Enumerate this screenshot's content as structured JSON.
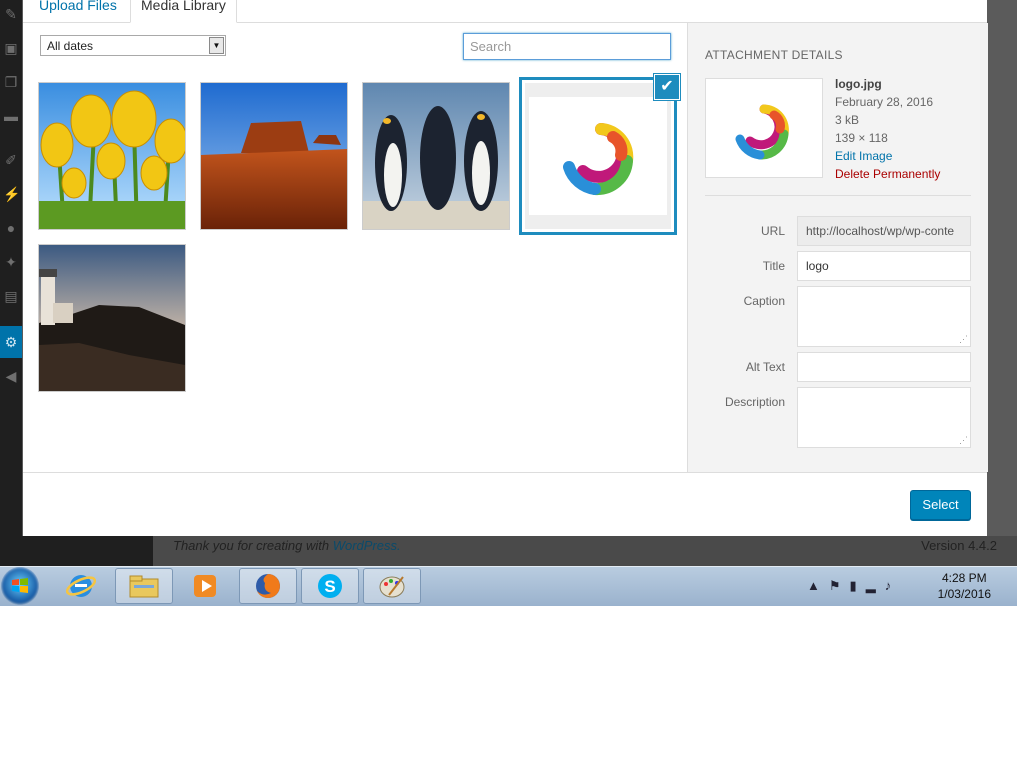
{
  "tabs": {
    "upload": "Upload Files",
    "library": "Media Library"
  },
  "filter": {
    "dates": "All dates",
    "search_placeholder": "Search"
  },
  "media": [
    {
      "name": "tulips"
    },
    {
      "name": "desert"
    },
    {
      "name": "penguins"
    },
    {
      "name": "logo",
      "selected": true
    },
    {
      "name": "lighthouse"
    }
  ],
  "details": {
    "heading": "ATTACHMENT DETAILS",
    "filename": "logo.jpg",
    "date": "February 28, 2016",
    "size": "3 kB",
    "dimensions": "139 × 118",
    "edit": "Edit Image",
    "delete": "Delete Permanently",
    "fields": {
      "url_label": "URL",
      "url_value": "http://localhost/wp/wp-conte",
      "title_label": "Title",
      "title_value": "logo",
      "caption_label": "Caption",
      "alt_label": "Alt Text",
      "description_label": "Description"
    }
  },
  "toolbar": {
    "select": "Select"
  },
  "footer": {
    "thanks": "Thank you for creating with",
    "wordpress": "WordPress.",
    "version": "Version 4.4.2"
  },
  "taskbar": {
    "time": "4:28 PM",
    "date": "1/03/2016"
  },
  "colors": {
    "accent": "#0085ba",
    "selection": "#1e8cbe",
    "delete": "#aa0000"
  }
}
